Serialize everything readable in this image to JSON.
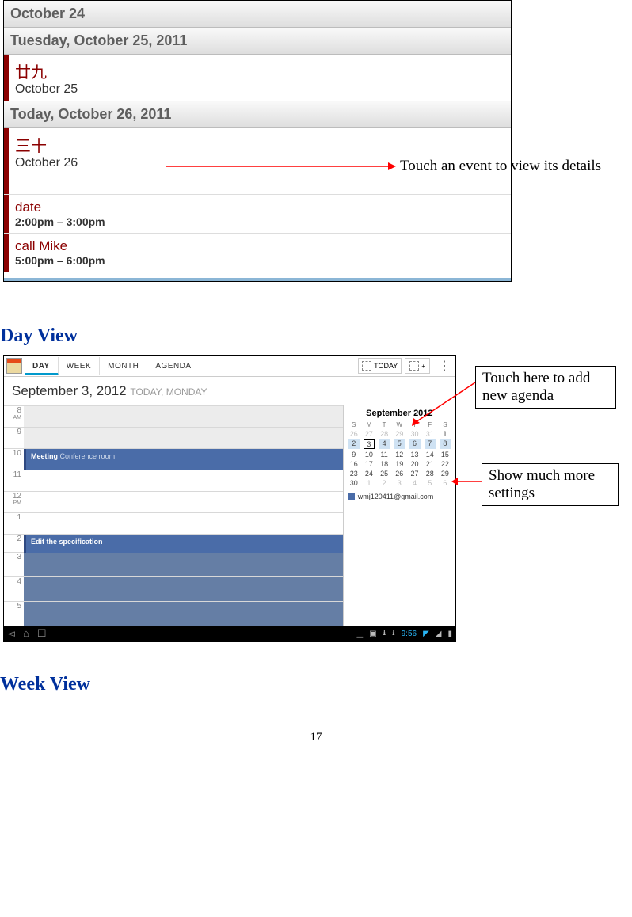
{
  "agenda": {
    "header_oct24": "October 24",
    "header_oct25": "Tuesday, October 25, 2011",
    "lunar25": "廿九",
    "sub25": "October 25",
    "header_oct26": "Today, October 26, 2011",
    "lunar26": "三十",
    "sub26": "October 26",
    "ev_date_title": "date",
    "ev_date_time": "2:00pm – 3:00pm",
    "ev_call_title": "call Mike",
    "ev_call_time": "5:00pm – 6:00pm"
  },
  "annotations": {
    "touch_event": "Touch an event to view its details",
    "touch_add": "Touch here to add new agenda",
    "show_more": "Show much more settings"
  },
  "headings": {
    "day": "Day View",
    "week": "Week View"
  },
  "day": {
    "tabs": {
      "day": "DAY",
      "week": "WEEK",
      "month": "MONTH",
      "agenda": "AGENDA",
      "today": "TODAY"
    },
    "date_big": "September 3, 2012",
    "date_sub": "TODAY, MONDAY",
    "hours": [
      "8",
      "9",
      "10",
      "11",
      "12",
      "1",
      "2",
      "3",
      "4",
      "5"
    ],
    "am": "AM",
    "pm": "PM",
    "ev_meeting": "Meeting",
    "ev_meeting_loc": "Conference room",
    "ev_edit": "Edit the specification",
    "mini": {
      "title": "September 2012",
      "days": [
        "S",
        "M",
        "T",
        "W",
        "T",
        "F",
        "S"
      ],
      "grid": [
        [
          "26",
          "27",
          "28",
          "29",
          "30",
          "31",
          "1"
        ],
        [
          "2",
          "3",
          "4",
          "5",
          "6",
          "7",
          "8"
        ],
        [
          "9",
          "10",
          "11",
          "12",
          "13",
          "14",
          "15"
        ],
        [
          "16",
          "17",
          "18",
          "19",
          "20",
          "21",
          "22"
        ],
        [
          "23",
          "24",
          "25",
          "26",
          "27",
          "28",
          "29"
        ],
        [
          "30",
          "1",
          "2",
          "3",
          "4",
          "5",
          "6"
        ]
      ],
      "account": "wmj120411@gmail.com"
    },
    "clock": "9:56"
  },
  "page_number": "17"
}
